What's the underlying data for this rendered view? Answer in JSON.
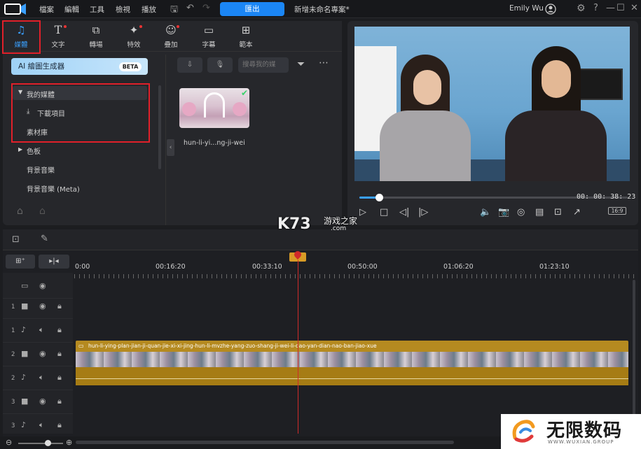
{
  "menu": [
    "檔案",
    "編輯",
    "工具",
    "檢視",
    "播放"
  ],
  "toolbar": {
    "export_label": "匯出",
    "project_name": "新增未命名專案*",
    "user_name": "Emily Wu"
  },
  "library_tabs": [
    {
      "label": "媒體",
      "icon": "media-icon",
      "active": true
    },
    {
      "label": "文字",
      "icon": "text-icon"
    },
    {
      "label": "轉場",
      "icon": "transition-icon"
    },
    {
      "label": "特效",
      "icon": "effects-icon"
    },
    {
      "label": "疊加",
      "icon": "overlay-icon"
    },
    {
      "label": "字幕",
      "icon": "subtitle-icon"
    },
    {
      "label": "範本",
      "icon": "template-icon"
    }
  ],
  "ai_button": {
    "label": "AI 繪圖生成器",
    "badge": "BETA"
  },
  "tree": {
    "my_media": "我的媒體",
    "downloads": "下載項目",
    "stock": "素材庫",
    "color_board": "色板",
    "background_music": "背景音樂",
    "background_music_meta": "背景音樂 (Meta)"
  },
  "media": {
    "search_placeholder": "搜尋我的媒",
    "thumb_label": "hun-li-yi...ng-ji-wei"
  },
  "preview": {
    "timecode": "00: 00: 38: 23",
    "aspect": "16:9",
    "progress": 0.07
  },
  "timeline": {
    "ruler_labels": [
      "0:00",
      "00:16:20",
      "00:33:10",
      "00:50:00",
      "01:06:20",
      "01:23:10"
    ],
    "clip_title": "hun-li-ying-plan-jian-ji-quan-jie-xi-xi-jing-hun-li-mvzhe-yang-zuo-shang-ji-wei-li-dao-yan-dian-nao-ban-jiao-xue",
    "tracks": [
      {
        "num": "1",
        "type": "video"
      },
      {
        "num": "1",
        "type": "audio"
      },
      {
        "num": "2",
        "type": "video"
      },
      {
        "num": "2",
        "type": "audio"
      },
      {
        "num": "3",
        "type": "video"
      },
      {
        "num": "3",
        "type": "audio"
      }
    ]
  },
  "watermarks": {
    "k73": "K73",
    "k73_cn": "游戏之家",
    "k73_com": ".com",
    "brand": "无限数码",
    "brand_sub": "WWW.WUXIAN.GROUP"
  },
  "colors": {
    "accent": "#1b86f5",
    "clip": "#b58a20",
    "playhead": "#d02a2a",
    "highlight_box": "#e0202a"
  }
}
